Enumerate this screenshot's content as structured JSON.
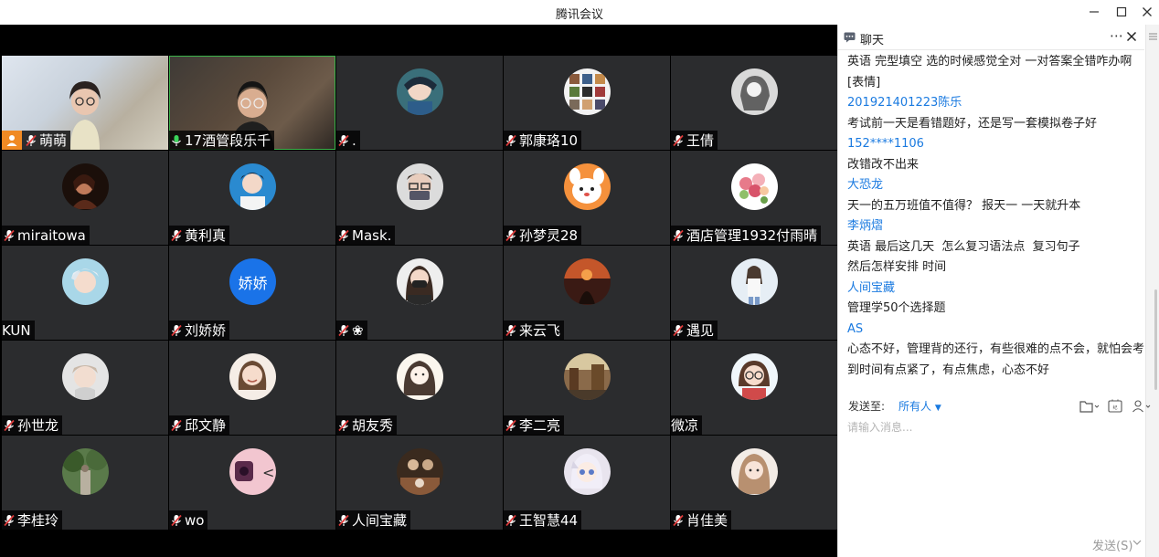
{
  "window": {
    "title": "腾讯会议"
  },
  "colors": {
    "accent": "#1a7ae0",
    "host": "#f08a24",
    "active_speaker": "#3bb34a",
    "tile_bg": "#2b2c2e"
  },
  "participants": [
    {
      "name": "萌萌",
      "kind": "camera-woman",
      "host": true,
      "mic": "muted"
    },
    {
      "name": "17酒管段乐千",
      "kind": "camera-man",
      "mic": "active",
      "active": true
    },
    {
      "name": ".",
      "kind": "avatar-anime-boy",
      "mic": "muted"
    },
    {
      "name": "郭康珞10",
      "kind": "avatar-grid",
      "mic": "muted"
    },
    {
      "name": "王倩",
      "kind": "avatar-girl-mono",
      "mic": "muted"
    },
    {
      "name": "miraitowa",
      "kind": "avatar-dark-portrait",
      "mic": "muted"
    },
    {
      "name": "黄利真",
      "kind": "avatar-boy-blue",
      "mic": "muted"
    },
    {
      "name": "Mask.",
      "kind": "avatar-boy-glasses",
      "mic": "muted"
    },
    {
      "name": "孙梦灵28",
      "kind": "avatar-cartoon-dog",
      "mic": "muted"
    },
    {
      "name": "酒店管理1932付雨晴",
      "kind": "avatar-flowers",
      "mic": "muted"
    },
    {
      "name": "KUN",
      "kind": "avatar-boy-silver",
      "mic": "none"
    },
    {
      "name": "刘娇娇",
      "kind": "avatar-text",
      "avatar_text": "娇娇",
      "mic": "muted"
    },
    {
      "name": "❀",
      "kind": "avatar-girl-mask",
      "mic": "muted"
    },
    {
      "name": "来云飞",
      "kind": "avatar-sunset",
      "mic": "muted"
    },
    {
      "name": "遇见",
      "kind": "avatar-girl-standing",
      "mic": "muted"
    },
    {
      "name": "孙世龙",
      "kind": "avatar-boy-light",
      "mic": "muted"
    },
    {
      "name": "邱文静",
      "kind": "avatar-girl-smile",
      "mic": "muted"
    },
    {
      "name": "胡友秀",
      "kind": "avatar-girl-sketch",
      "mic": "muted"
    },
    {
      "name": "李二亮",
      "kind": "avatar-street",
      "mic": "muted"
    },
    {
      "name": "微凉",
      "kind": "avatar-girl-glasses",
      "mic": "none"
    },
    {
      "name": "李桂玲",
      "kind": "avatar-forest",
      "mic": "muted"
    },
    {
      "name": "wo",
      "kind": "avatar-pink-object",
      "mic": "muted"
    },
    {
      "name": "人间宝藏",
      "kind": "avatar-dining",
      "mic": "muted"
    },
    {
      "name": "王智慧44",
      "kind": "avatar-anime-girl",
      "mic": "muted"
    },
    {
      "name": "肖佳美",
      "kind": "avatar-girl-long-hair",
      "mic": "muted"
    }
  ],
  "chat": {
    "title": "聊天",
    "messages": [
      {
        "sender": "",
        "text": "英语 完型填空 选的时候感觉全对 一对答案全错咋办啊[表情]"
      },
      {
        "sender": "201921401223陈乐",
        "text": "考试前一天是看错题好，还是写一套模拟卷子好"
      },
      {
        "sender": "152****1106",
        "text": "改错改不出来"
      },
      {
        "sender": "大恐龙",
        "text": "天一的五万班值不值得？ 报天一 一天就升本"
      },
      {
        "sender": "李炳熠",
        "text": "英语 最后这几天  怎么复习语法点  复习句子\n然后怎样安排 时间"
      },
      {
        "sender": "人间宝藏",
        "text": "管理学50个选择题"
      },
      {
        "sender": "AS",
        "text": "心态不好，管理背的还行，有些很难的点不会，就怕会考到时间有点紧了，有点焦虑，心态不好"
      }
    ],
    "send_to_label": "发送至:",
    "recipient": "所有人",
    "input_placeholder": "请输入消息...",
    "send_label": "发送(S)"
  }
}
